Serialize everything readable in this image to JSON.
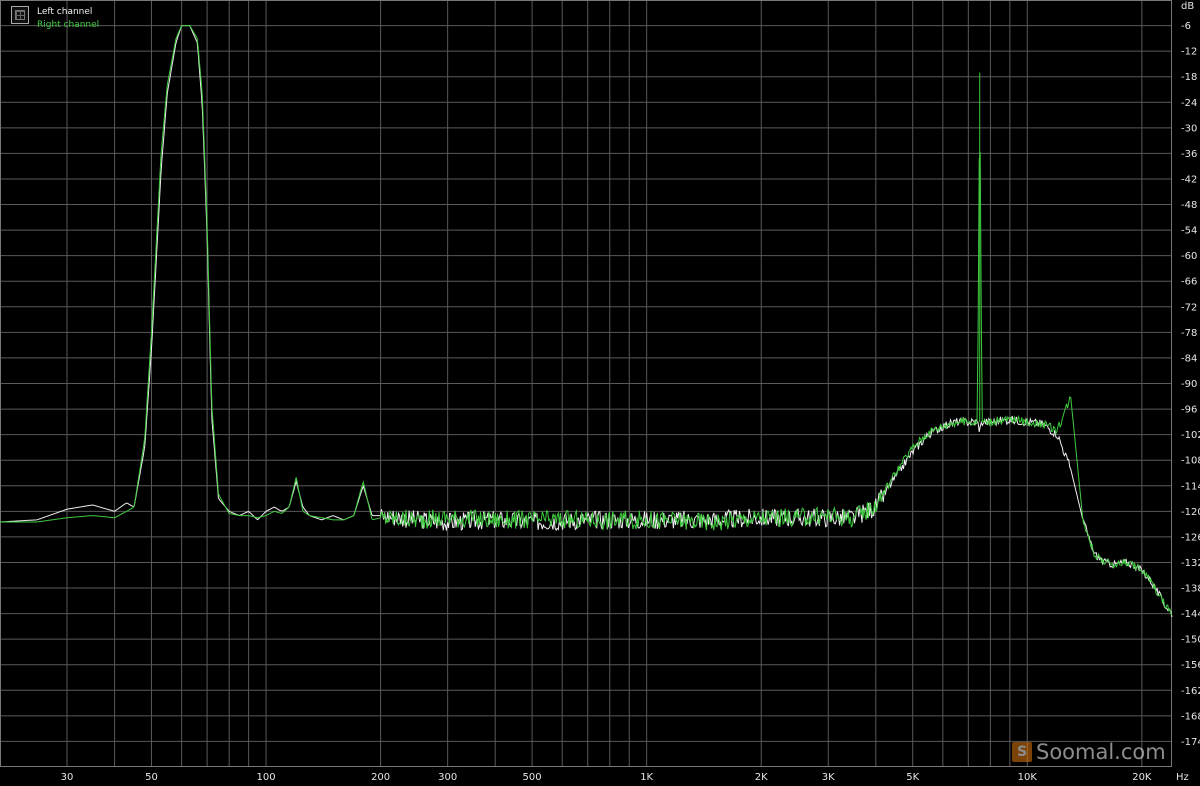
{
  "chart_data": {
    "type": "line",
    "title": "",
    "xlabel": "Hz",
    "ylabel": "dB",
    "xscale": "log",
    "xlim": [
      20,
      24000
    ],
    "ylim": [
      -180,
      0
    ],
    "grid": true,
    "legend_placement": "top-left",
    "x_tick_labels": [
      {
        "value": 30,
        "label": "30"
      },
      {
        "value": 50,
        "label": "50"
      },
      {
        "value": 100,
        "label": "100"
      },
      {
        "value": 200,
        "label": "200"
      },
      {
        "value": 300,
        "label": "300"
      },
      {
        "value": 500,
        "label": "500"
      },
      {
        "value": 1000,
        "label": "1K"
      },
      {
        "value": 2000,
        "label": "2K"
      },
      {
        "value": 3000,
        "label": "3K"
      },
      {
        "value": 5000,
        "label": "5K"
      },
      {
        "value": 10000,
        "label": "10K"
      },
      {
        "value": 20000,
        "label": "20K"
      }
    ],
    "y_ticks": [
      -6,
      -12,
      -18,
      -24,
      -30,
      -36,
      -42,
      -48,
      -54,
      -60,
      -66,
      -72,
      -78,
      -84,
      -90,
      -96,
      -102,
      -108,
      -114,
      -120,
      -126,
      -132,
      -138,
      -144,
      -150,
      -156,
      -162,
      -168,
      -174
    ],
    "series": [
      {
        "name": "Left channel",
        "color": "#f0f0f0",
        "x": [
          20,
          25,
          30,
          35,
          40,
          43,
          45,
          48,
          50,
          53,
          55,
          58,
          60,
          63,
          66,
          68,
          70,
          72,
          75,
          80,
          85,
          90,
          95,
          100,
          105,
          110,
          115,
          120,
          125,
          130,
          140,
          150,
          160,
          170,
          180,
          190,
          200,
          250,
          300,
          400,
          500,
          700,
          1000,
          1500,
          2000,
          2500,
          3000,
          3500,
          4000,
          4500,
          5000,
          5500,
          6000,
          6500,
          7000,
          7400,
          7500,
          7600,
          8000,
          9000,
          10000,
          11000,
          12000,
          13000,
          14000,
          15000,
          16000,
          17000,
          18000,
          19000,
          20000,
          21000,
          22000,
          23000,
          24000
        ],
        "y": [
          -122.5,
          -122,
          -119.5,
          -118.5,
          -120,
          -118,
          -119,
          -105,
          -82,
          -40,
          -22,
          -10,
          -6,
          -6,
          -10,
          -25,
          -55,
          -98,
          -117,
          -120,
          -121,
          -120,
          -122,
          -120,
          -119,
          -120,
          -119,
          -113,
          -119,
          -121,
          -122,
          -121,
          -122,
          -121,
          -114,
          -121,
          -121,
          -122,
          -122.5,
          -122,
          -122.5,
          -122,
          -122,
          -122,
          -121.5,
          -121.5,
          -121.5,
          -121.5,
          -119,
          -112,
          -106,
          -102,
          -100,
          -99,
          -99,
          -99,
          -101,
          -99,
          -99,
          -98.5,
          -99,
          -99.5,
          -102,
          -110,
          -122,
          -130,
          -132,
          -132.5,
          -132,
          -132.5,
          -134,
          -136,
          -139,
          -142,
          -144
        ]
      },
      {
        "name": "Right channel",
        "color": "#3ecb3e",
        "x": [
          20,
          25,
          30,
          35,
          40,
          43,
          45,
          48,
          50,
          53,
          55,
          58,
          60,
          63,
          66,
          68,
          70,
          72,
          75,
          80,
          85,
          90,
          95,
          100,
          105,
          110,
          115,
          120,
          125,
          130,
          140,
          150,
          160,
          170,
          180,
          190,
          200,
          250,
          300,
          400,
          500,
          700,
          1000,
          1500,
          2000,
          2500,
          3000,
          3500,
          4000,
          4500,
          5000,
          5500,
          6000,
          6500,
          7000,
          7400,
          7500,
          7600,
          8000,
          9000,
          10000,
          11000,
          12000,
          13000,
          14000,
          15000,
          16000,
          17000,
          18000,
          19000,
          20000,
          21000,
          22000,
          23000,
          24000
        ],
        "y": [
          -122.5,
          -122.5,
          -121.5,
          -121,
          -121.5,
          -120,
          -119,
          -103,
          -78,
          -36,
          -20,
          -9,
          -6,
          -6,
          -9,
          -22,
          -52,
          -95,
          -116,
          -120.5,
          -121,
          -121,
          -121.5,
          -121,
          -120,
          -120.5,
          -119,
          -112,
          -120,
          -121,
          -121.5,
          -122,
          -122,
          -121,
          -113,
          -122,
          -121.5,
          -122,
          -121.5,
          -122,
          -122,
          -122,
          -122,
          -122.5,
          -121.5,
          -121.5,
          -121,
          -121.5,
          -118.5,
          -111,
          -105,
          -101.5,
          -100,
          -99,
          -99,
          -99,
          -17,
          -99,
          -99,
          -98.5,
          -99,
          -99.5,
          -101,
          -93,
          -122,
          -130,
          -132,
          -132.5,
          -132,
          -132.5,
          -134,
          -136,
          -139,
          -142,
          -144
        ]
      }
    ]
  },
  "legend": {
    "left": "Left channel",
    "right": "Right channel"
  },
  "watermark": {
    "logo": "S",
    "text": "Soomal.com"
  }
}
